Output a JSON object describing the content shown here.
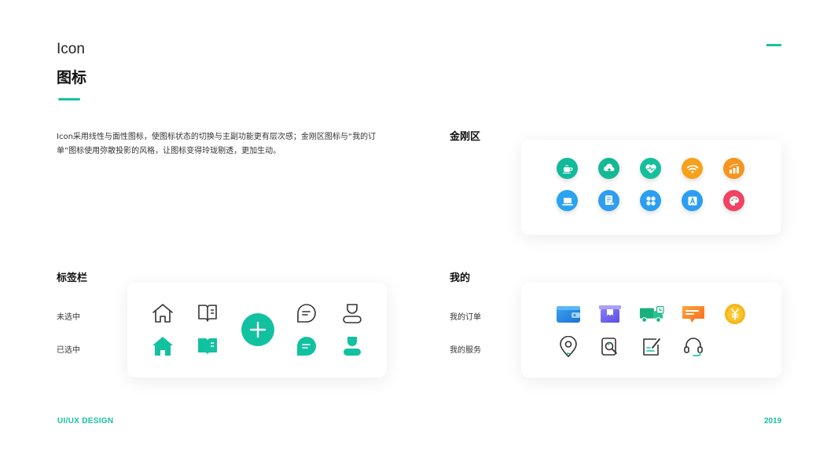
{
  "header": {
    "title_en": "Icon",
    "title_zh": "图标"
  },
  "description": "Icon采用线性与面性图标，使图标状态的切换与主副功能更有层次感；金刚区图标与“我的订单”图标使用弥散投影的风格，让图标变得玲珑剔透，更加生动。",
  "jingang": {
    "label": "金刚区",
    "icons": [
      {
        "name": "coffee-icon",
        "color": "#12b99a"
      },
      {
        "name": "cloud-upload-icon",
        "color": "#14b893"
      },
      {
        "name": "heart-pulse-icon",
        "color": "#15bf99"
      },
      {
        "name": "wifi-icon",
        "color": "#f7a11a"
      },
      {
        "name": "bar-chart-icon",
        "color": "#f7941d"
      },
      {
        "name": "laptop-icon",
        "color": "#2aa3f0"
      },
      {
        "name": "document-icon",
        "color": "#2f9df0"
      },
      {
        "name": "apps-grid-icon",
        "color": "#2a9ff2"
      },
      {
        "name": "font-a-icon",
        "color": "#2a9ef2"
      },
      {
        "name": "palette-icon",
        "color": "#f04462"
      }
    ]
  },
  "tabbar": {
    "label": "标签栏",
    "unselected_label": "未选中",
    "selected_label": "已选中",
    "icons": [
      "home-icon",
      "book-icon",
      "plus-icon",
      "chat-icon",
      "user-icon"
    ],
    "accent": "#12c19f"
  },
  "mine": {
    "label": "我的",
    "orders_label": "我的订单",
    "services_label": "我的服务",
    "order_icons": [
      "wallet-icon",
      "box-icon",
      "truck-icon",
      "message-icon",
      "yen-coin-icon"
    ],
    "service_icons": [
      "location-pin-icon",
      "search-document-icon",
      "edit-icon",
      "headset-icon"
    ]
  },
  "footer": {
    "left": "UI/UX DESIGN",
    "right": "2019"
  },
  "colors": {
    "accent": "#17c2a0"
  }
}
